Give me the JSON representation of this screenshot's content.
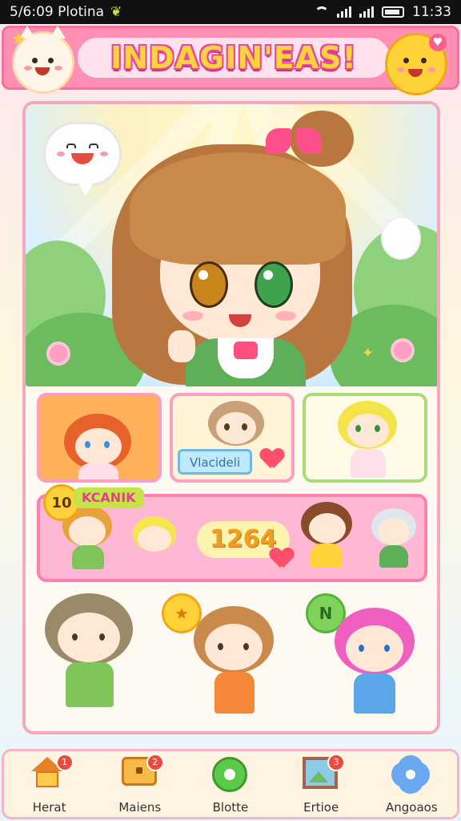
{
  "status_bar": {
    "time_text": "5/6:09 Plotina",
    "clock": "11:33"
  },
  "header": {
    "title": "INDAGIN'EAS!"
  },
  "cards": {
    "top_left": {
      "level": "10",
      "ribbon": "KCANIK"
    },
    "top_middle": {
      "banner": "Vlacideli"
    },
    "pink_bar": {
      "count": "1264"
    },
    "bubble_yellow": "★",
    "bubble_green": "N"
  },
  "bottom_nav": {
    "items": [
      {
        "label": "Herat",
        "icon": "house-icon",
        "badge": "1"
      },
      {
        "label": "Maiens",
        "icon": "chest-icon",
        "badge": "2"
      },
      {
        "label": "Blotte",
        "icon": "green-orb-icon",
        "badge": ""
      },
      {
        "label": "Ertioe",
        "icon": "picture-frame-icon",
        "badge": "3"
      },
      {
        "label": "Angoaos",
        "icon": "flower-icon",
        "badge": ""
      }
    ]
  },
  "colors": {
    "header_pink": "#ff8fb3",
    "title_yellow": "#ffd23f",
    "accent_green": "#7fd35a"
  }
}
